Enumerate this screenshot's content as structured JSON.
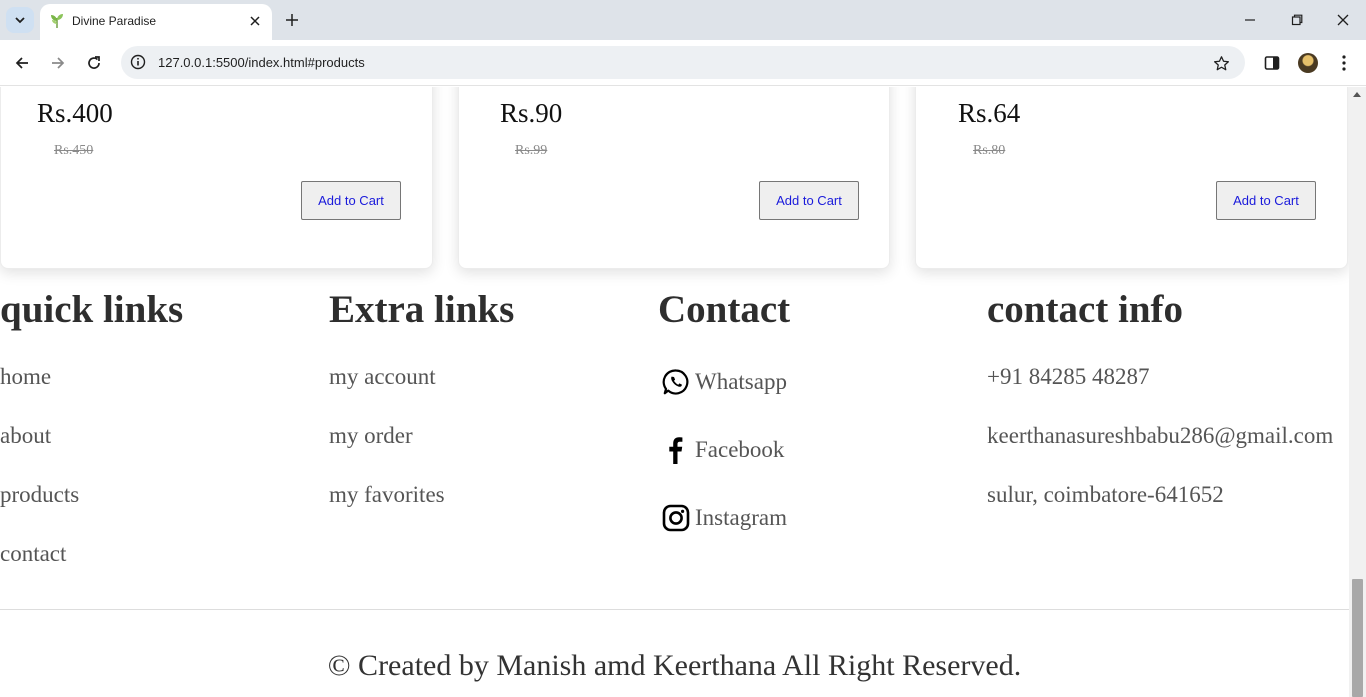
{
  "browser": {
    "tab_title": "Divine Paradise",
    "url": "127.0.0.1:5500/index.html#products"
  },
  "products": [
    {
      "price": "Rs.400",
      "old_price": "Rs.450",
      "button": "Add to Cart"
    },
    {
      "price": "Rs.90",
      "old_price": "Rs.99",
      "button": "Add to Cart"
    },
    {
      "price": "Rs.64",
      "old_price": "Rs.80",
      "button": "Add to Cart"
    }
  ],
  "footer": {
    "quick_links": {
      "title": "quick links",
      "items": [
        "home",
        "about",
        "products",
        "contact"
      ]
    },
    "extra_links": {
      "title": "Extra links",
      "items": [
        "my account",
        "my order",
        "my favorites"
      ]
    },
    "contact": {
      "title": "Contact",
      "items": [
        {
          "label": "Whatsapp",
          "icon": "whatsapp-icon"
        },
        {
          "label": "Facebook",
          "icon": "facebook-icon"
        },
        {
          "label": "Instagram",
          "icon": "instagram-icon"
        }
      ]
    },
    "contact_info": {
      "title": "contact info",
      "phone": "+91 84285 48287",
      "email": "keerthanasureshbabu286@gmail.com",
      "address": "sulur, coimbatore-641652"
    },
    "credit": "© Created by Manish amd Keerthana All Right Reserved."
  }
}
